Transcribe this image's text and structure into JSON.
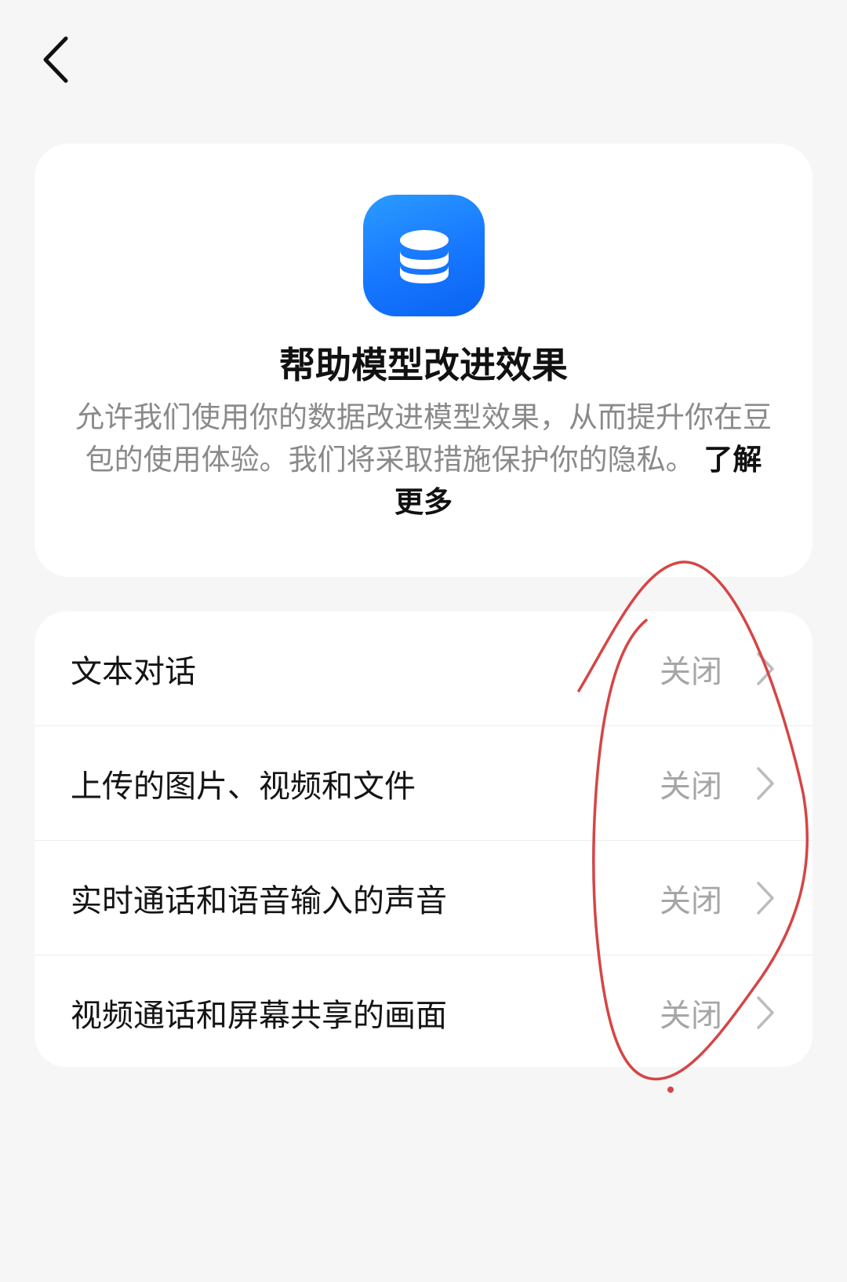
{
  "header": {
    "back_icon": "chevron-left-icon"
  },
  "info_card": {
    "icon": "database-icon",
    "icon_color": "#1677ff",
    "title": "帮助模型改进效果",
    "description": "允许我们使用你的数据改进模型效果，从而提升你在豆包的使用体验。我们将采取措施保护你的隐私。",
    "learn_more": "了解更多"
  },
  "settings": {
    "items": [
      {
        "label": "文本对话",
        "value": "关闭"
      },
      {
        "label": "上传的图片、视频和文件",
        "value": "关闭"
      },
      {
        "label": "实时通话和语音输入的声音",
        "value": "关闭"
      },
      {
        "label": "视频通话和屏幕共享的画面",
        "value": "关闭"
      }
    ]
  },
  "annotation": {
    "shape": "hand-drawn-circle",
    "color": "#d64545"
  }
}
